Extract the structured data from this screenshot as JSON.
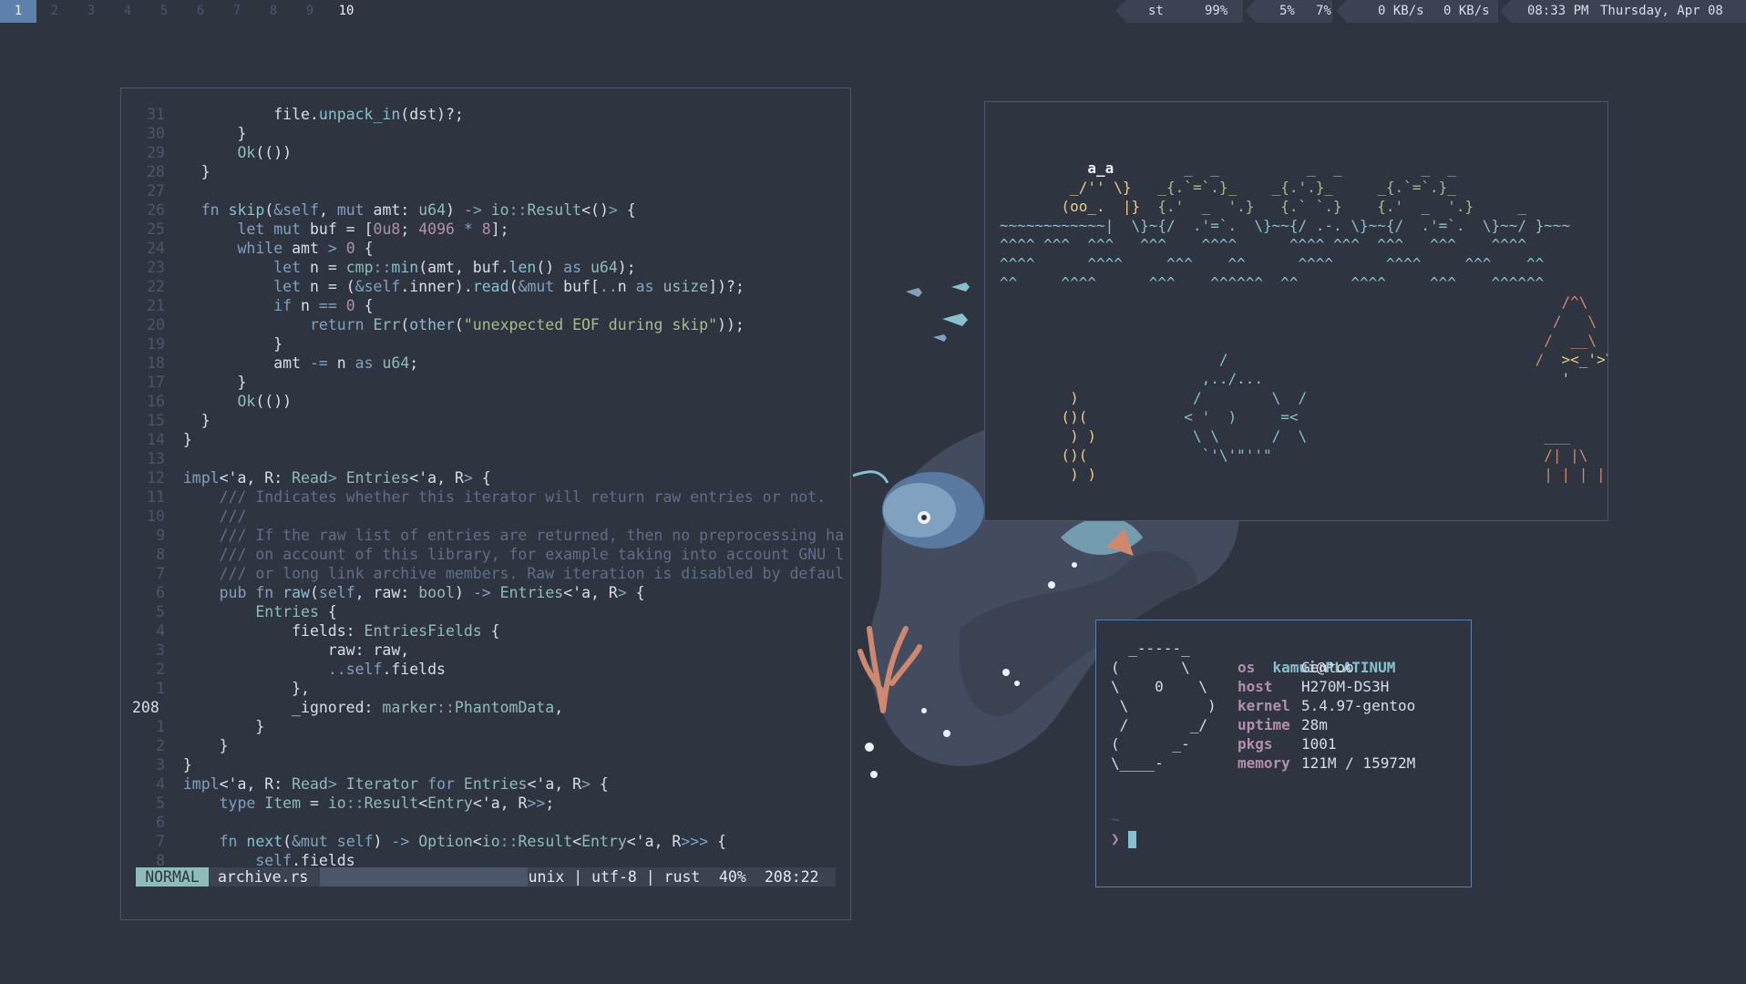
{
  "bar": {
    "workspaces": [
      "1",
      "2",
      "3",
      "4",
      "5",
      "6",
      "7",
      "8",
      "9",
      "10"
    ],
    "active_workspace": "1",
    "window_title": "st",
    "battery": "99%",
    "cpu1": "5%",
    "cpu2": "7%",
    "net_down": "0 KB/s",
    "net_up": "0 KB/s",
    "time": "08:33 PM",
    "date": "Thursday, Apr 08"
  },
  "editor": {
    "lines": [
      {
        "num": "31",
        "code": "          file.unpack_in(dst)?;"
      },
      {
        "num": "30",
        "code": "      }"
      },
      {
        "num": "29",
        "code": "      Ok(())"
      },
      {
        "num": "28",
        "code": "  }"
      },
      {
        "num": "27",
        "code": ""
      },
      {
        "num": "26",
        "code": "  fn skip(&self, mut amt: u64) -> io::Result<()> {"
      },
      {
        "num": "25",
        "code": "      let mut buf = [0u8; 4096 * 8];"
      },
      {
        "num": "24",
        "code": "      while amt > 0 {"
      },
      {
        "num": "23",
        "code": "          let n = cmp::min(amt, buf.len() as u64);"
      },
      {
        "num": "22",
        "code": "          let n = (&self.inner).read(&mut buf[..n as usize])?;"
      },
      {
        "num": "21",
        "code": "          if n == 0 {"
      },
      {
        "num": "20",
        "code": "              return Err(other(\"unexpected EOF during skip\"));"
      },
      {
        "num": "19",
        "code": "          }"
      },
      {
        "num": "18",
        "code": "          amt -= n as u64;"
      },
      {
        "num": "17",
        "code": "      }"
      },
      {
        "num": "16",
        "code": "      Ok(())"
      },
      {
        "num": "15",
        "code": "  }"
      },
      {
        "num": "14",
        "code": "}"
      },
      {
        "num": "13",
        "code": ""
      },
      {
        "num": "12",
        "code": "impl<'a, R: Read> Entries<'a, R> {"
      },
      {
        "num": "11",
        "code": "    /// Indicates whether this iterator will return raw entries or not."
      },
      {
        "num": "10",
        "code": "    ///"
      },
      {
        "num": "9",
        "code": "    /// If the raw list of entries are returned, then no preprocessing ha"
      },
      {
        "num": "8",
        "code": "    /// on account of this library, for example taking into account GNU l"
      },
      {
        "num": "7",
        "code": "    /// or long link archive members. Raw iteration is disabled by defaul"
      },
      {
        "num": "6",
        "code": "    pub fn raw(self, raw: bool) -> Entries<'a, R> {"
      },
      {
        "num": "5",
        "code": "        Entries {"
      },
      {
        "num": "4",
        "code": "            fields: EntriesFields {"
      },
      {
        "num": "3",
        "code": "                raw: raw,"
      },
      {
        "num": "2",
        "code": "                ..self.fields"
      },
      {
        "num": "1",
        "code": "            },"
      },
      {
        "num": "208",
        "code": "            _ignored: marker::PhantomData,"
      },
      {
        "num": "1",
        "code": "        }"
      },
      {
        "num": "2",
        "code": "    }"
      },
      {
        "num": "3",
        "code": "}"
      },
      {
        "num": "4",
        "code": "impl<'a, R: Read> Iterator for Entries<'a, R> {"
      },
      {
        "num": "5",
        "code": "    type Item = io::Result<Entry<'a, R>>;"
      },
      {
        "num": "6",
        "code": ""
      },
      {
        "num": "7",
        "code": "    fn next(&mut self) -> Option<io::Result<Entry<'a, R>>> {"
      },
      {
        "num": "8",
        "code": "        self.fields"
      }
    ],
    "status": {
      "mode": "NORMAL",
      "file": "archive.rs",
      "info": "unix | utf-8 | rust",
      "percent": "40%",
      "position": "208:22"
    }
  },
  "fetch": {
    "user": "kamui",
    "at": "@",
    "host_name": "PLATINUM",
    "fields": [
      {
        "key": "os",
        "value": "Gentoo"
      },
      {
        "key": "host",
        "value": "H270M-DS3H"
      },
      {
        "key": "kernel",
        "value": "5.4.97-gentoo"
      },
      {
        "key": "uptime",
        "value": "28m"
      },
      {
        "key": "pkgs",
        "value": "1001"
      },
      {
        "key": "memory",
        "value": "121M / 15972M"
      }
    ],
    "cwd": "~",
    "prompt": "❯"
  },
  "colors": {
    "background": "#2e3440",
    "accent": "#5e81ac",
    "mode": "#8fbcbb",
    "keyword": "#81a1c1",
    "string": "#a3be8c",
    "number": "#b48ead"
  }
}
